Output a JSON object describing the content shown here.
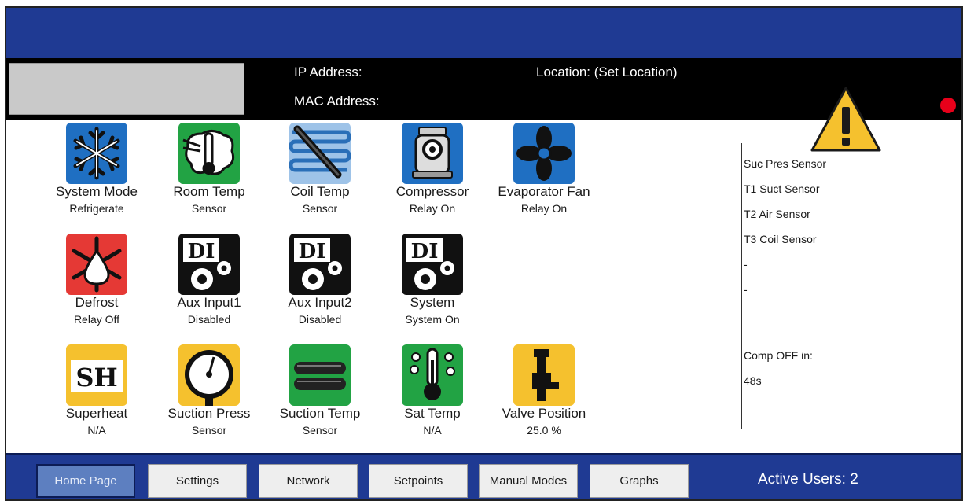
{
  "header": {
    "ip_label": "IP Address:",
    "mac_label": "MAC Address:",
    "location_label": "Location: (Set Location)",
    "status_dot_color": "#e8001a",
    "alert_icon": "warning-triangle-icon"
  },
  "tiles": [
    {
      "title": "System Mode",
      "status": "Refrigerate",
      "icon": "snowflake-icon",
      "color": "#1f6fc2"
    },
    {
      "title": "Room Temp",
      "status": "Sensor",
      "icon": "room-temp-icon",
      "color": "#22a344"
    },
    {
      "title": "Coil Temp",
      "status": "Sensor",
      "icon": "coil-temp-icon",
      "color": "#1f6fc2"
    },
    {
      "title": "Compressor",
      "status": "Relay On",
      "icon": "compressor-icon",
      "color": "#1f6fc2"
    },
    {
      "title": "Evaporator Fan",
      "status": "Relay On",
      "icon": "fan-icon",
      "color": "#1f6fc2"
    },
    {
      "title": "Defrost",
      "status": "Relay Off",
      "icon": "defrost-icon",
      "color": "#e53935"
    },
    {
      "title": "Aux Input1",
      "status": "Disabled",
      "icon": "di-gear-icon",
      "color": "#111111"
    },
    {
      "title": "Aux Input2",
      "status": "Disabled",
      "icon": "di-gear-icon",
      "color": "#111111"
    },
    {
      "title": "System",
      "status": "System On",
      "icon": "di-gear-icon",
      "color": "#111111"
    },
    {
      "title": "Superheat",
      "status": "N/A",
      "icon": "superheat-icon",
      "color": "#f5c12e"
    },
    {
      "title": "Suction Press",
      "status": "Sensor",
      "icon": "pressure-gauge-icon",
      "color": "#f5c12e"
    },
    {
      "title": "Suction Temp",
      "status": "Sensor",
      "icon": "suction-pipe-icon",
      "color": "#22a344"
    },
    {
      "title": "Sat Temp",
      "status": "N/A",
      "icon": "thermometer-icon",
      "color": "#22a344"
    },
    {
      "title": "Valve Position",
      "status": "25.0 %",
      "icon": "valve-icon",
      "color": "#f5c12e"
    }
  ],
  "sidebar": {
    "sensors": [
      "Suc Pres Sensor",
      "T1 Suct Sensor",
      "T2 Air Sensor",
      "T3 Coil Sensor"
    ],
    "blank1": "-",
    "blank2": "-",
    "comp_label": "Comp OFF in:",
    "comp_value": "48s"
  },
  "nav": {
    "buttons": [
      "Home Page",
      "Settings",
      "Network",
      "Setpoints",
      "Manual Modes",
      "Graphs"
    ],
    "active_users": "Active Users: 2"
  },
  "colors": {
    "bar_blue": "#1f3a93",
    "active_button": "#5d7fc0"
  }
}
